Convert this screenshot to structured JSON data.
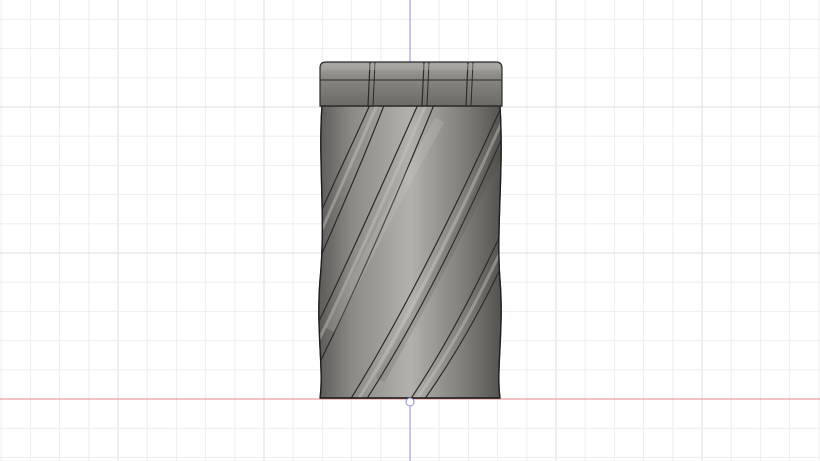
{
  "viewport": {
    "background": "#ffffff",
    "grid": {
      "visible": true,
      "minor_color": "#eeeeee",
      "major_color": "#dddddd"
    },
    "axes": {
      "x_axis_color": "#e38a8a",
      "z_axis_color": "#8f8fdc"
    }
  },
  "model": {
    "icon": "helical-cylinder-body",
    "view": "front",
    "shaded": true,
    "visible_edges": true,
    "body_color": "#8c8a84",
    "edge_color": "#2b2b2b",
    "cap_color": "#7f7d77",
    "cap_highlight": "#a4a29c",
    "groove_count_visible": 4
  }
}
